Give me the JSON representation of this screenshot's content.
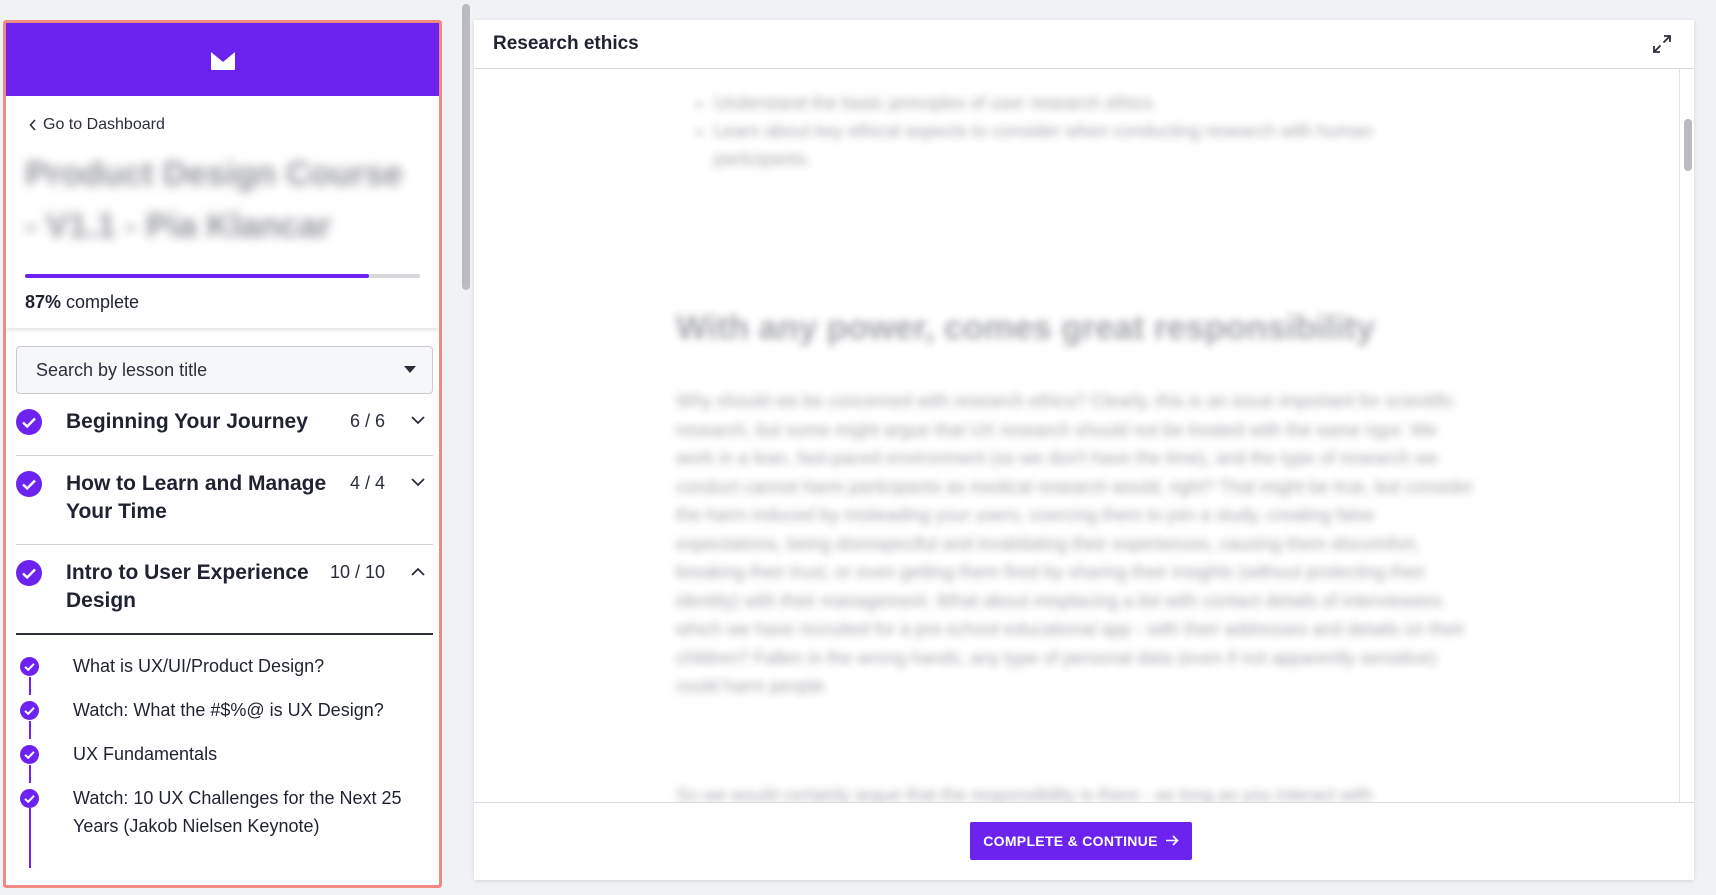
{
  "brand": {
    "logo_icon": "m-logo-icon",
    "color": "#6d23f0"
  },
  "sidebar": {
    "back_label": "Go to Dashboard",
    "course_title": "Product Design Course - V1.1 - Pia Klancar",
    "progress": {
      "percent": 87,
      "percent_label": "87%",
      "suffix": " complete"
    },
    "search": {
      "placeholder": "Search by lesson title"
    },
    "sections": [
      {
        "title": "Beginning Your Journey",
        "count": "6 / 6",
        "completed": true,
        "expanded": false
      },
      {
        "title": "How to Learn and Manage Your Time",
        "count": "4 / 4",
        "completed": true,
        "expanded": false
      },
      {
        "title": "Intro to User Experience Design",
        "count": "10 / 10",
        "completed": true,
        "expanded": true
      }
    ],
    "lessons": [
      {
        "title": "What is UX/UI/Product Design?",
        "completed": true
      },
      {
        "title": "Watch: What the #$%@ is UX Design?",
        "completed": true
      },
      {
        "title": "UX Fundamentals",
        "completed": true
      },
      {
        "title": "Watch: 10 UX Challenges for the Next 25 Years (Jakob Nielsen Keynote)",
        "completed": true
      }
    ]
  },
  "main": {
    "title": "Research ethics",
    "bullets": [
      "Understand the basic principles of user research ethics.",
      "Learn about key ethical aspects to consider when conducting research with human participants."
    ],
    "heading": "With any power, comes great responsibility",
    "paragraph": "Why should we be concerned with research ethics? Clearly, this is an issue important for scientific research, but some might argue that UX research should not be treated with the same rigor. We work in a lean, fast-paced environment (so we don't have the time), and the type of research we conduct cannot harm participants as medical research would, right? That might be true, but consider the harm induced by misleading your users, coercing them to join a study, creating false expectations, being disrespectful and invalidating their experiences, causing them discomfort, breaking their trust, or even getting them fired by sharing their insights (without protecting their identity) with their management. What about misplacing a list with contact details of interviewees which we have recruited for a pre-school educational app - with their addresses and details on their children? Fallen in the wrong hands, any type of personal data (even if not apparently sensitive) could harm people.",
    "paragraph2": "So we would certainly argue that the responsibility is there - as long as you interact with",
    "continue_label": "COMPLETE & CONTINUE",
    "continue_icon": "arrow-right-icon"
  }
}
